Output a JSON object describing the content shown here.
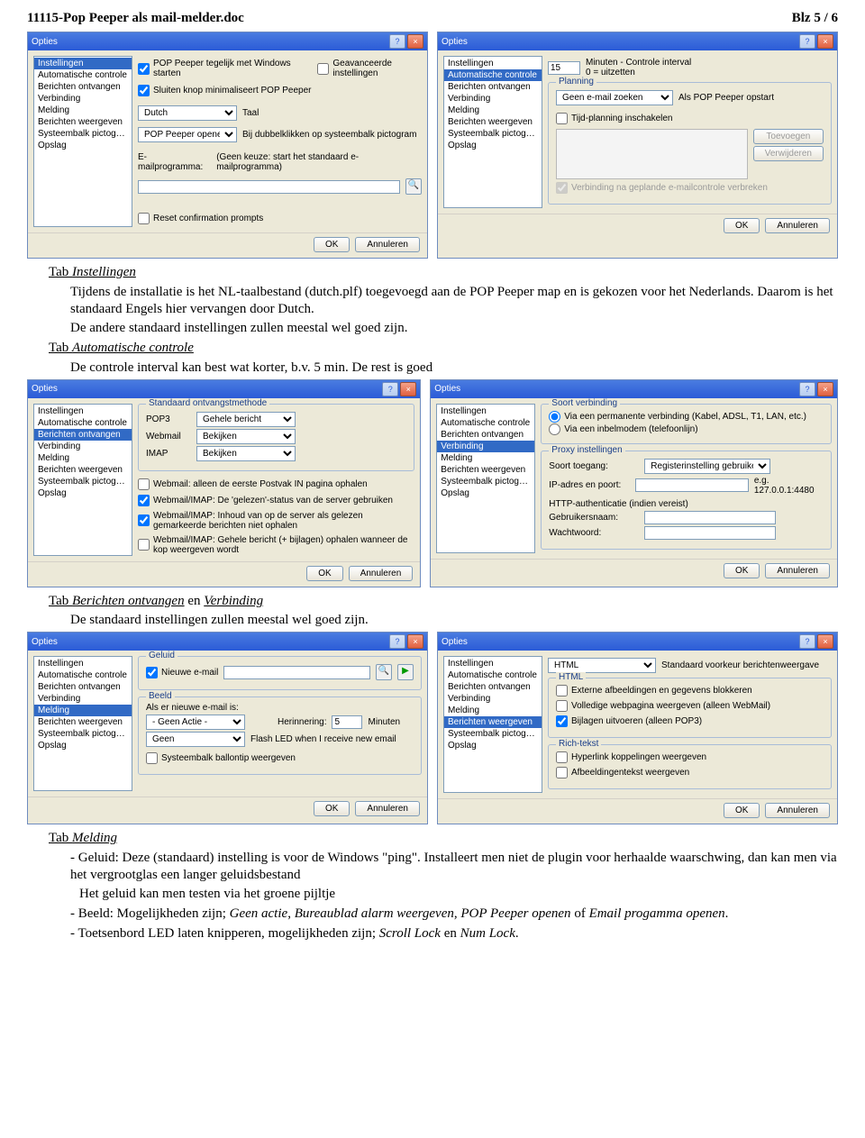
{
  "header": {
    "filename": "11115-Pop Peeper als mail-melder.doc",
    "page": "Blz 5 / 6"
  },
  "sidebar_items": [
    "Instellingen",
    "Automatische controle",
    "Berichten ontvangen",
    "Verbinding",
    "Melding",
    "Berichten weergeven",
    "Systeembalk pictogrammen",
    "Opslag"
  ],
  "dlg_title": "Opties",
  "ok": "OK",
  "cancel": "Annuleren",
  "d1": {
    "chk1": "POP Peeper tegelijk met Windows starten",
    "chk2": "Sluiten knop minimaliseert POP Peeper",
    "chk3": "Geavanceerde instellingen",
    "lang": "Dutch",
    "lang_label": "Taal",
    "action": "POP Peeper openen",
    "action_label": "Bij dubbelklikken op systeembalk pictogram",
    "mail_label": "E-mailprogramma:",
    "mail_val": "(Geen keuze: start het standaard e-mailprogramma)",
    "reset": "Reset confirmation prompts"
  },
  "d2": {
    "interval": "15",
    "interval_label": "Minuten - Controle interval\n0 = uitzetten",
    "grp": "Planning",
    "action": "Geen e-mail zoeken",
    "action_label": "Als POP Peeper opstart",
    "chk1": "Tijd-planning inschakelen",
    "add": "Toevoegen",
    "del": "Verwijderen",
    "chk2": "Verbinding na geplande e-mailcontrole verbreken"
  },
  "d3": {
    "grp": "Standaard ontvangstmethode",
    "r1": "POP3",
    "r1v": "Gehele bericht",
    "r2": "Webmail",
    "r2v": "Bekijken",
    "r3": "IMAP",
    "r3v": "Bekijken",
    "c1": "Webmail: alleen de eerste Postvak IN pagina ophalen",
    "c2": "Webmail/IMAP: De 'gelezen'-status van de server gebruiken",
    "c3": "Webmail/IMAP: Inhoud van op de server als gelezen gemarkeerde berichten niet ophalen",
    "c4": "Webmail/IMAP: Gehele bericht (+ bijlagen) ophalen wanneer de kop weergeven wordt"
  },
  "d4": {
    "grp1": "Soort verbinding",
    "rad1": "Via een permanente verbinding (Kabel, ADSL, T1, LAN, etc.)",
    "rad2": "Via een inbelmodem (telefoonlijn)",
    "grp2": "Proxy instellingen",
    "f1": "Soort toegang:",
    "f1v": "Registerinstelling gebruiken",
    "f2": "IP-adres en poort:",
    "f2h": "e.g. 127.0.0.1:4480",
    "f3": "HTTP-authenticatie (indien vereist)",
    "f4": "Gebruikersnaam:",
    "f5": "Wachtwoord:"
  },
  "d5": {
    "grp1": "Geluid",
    "c1": "Nieuwe e-mail",
    "grp2": "Beeld",
    "lbl1": "Als er nieuwe e-mail is:",
    "sel1": "- Geen Actie -",
    "lbl2": "Herinnering:",
    "val2": "5",
    "lbl3": "Minuten",
    "sel2": "Geen",
    "lbl4": "Flash LED when I receive new email",
    "c2": "Systeembalk ballontip weergeven"
  },
  "d6": {
    "sel1": "HTML",
    "lbl1": "Standaard voorkeur berichtenweergave",
    "grp1": "HTML",
    "c1": "Externe afbeeldingen en gegevens blokkeren",
    "c2": "Volledige webpagina weergeven (alleen WebMail)",
    "c3": "Bijlagen uitvoeren (alleen POP3)",
    "grp2": "Rich-tekst",
    "c4": "Hyperlink koppelingen weergeven",
    "c5": "Afbeeldingentekst weergeven"
  },
  "txt": {
    "t1a": "Tab ",
    "t1b": "Instellingen",
    "p1": "Tijdens de installatie is het NL-taalbestand (dutch.plf) toegevoegd aan de POP Peeper map en is gekozen voor het Nederlands. Daarom is het standaard Engels hier vervangen door Dutch.",
    "p2": "De andere standaard instellingen zullen meestal wel goed zijn.",
    "t2": "Automatische controle",
    "p3": "De controle interval kan best wat korter, b.v. 5 min. De rest is goed",
    "t3a": "Berichten ontvangen",
    "t3b": " en ",
    "t3c": "Verbinding",
    "p4": "De standaard instellingen zullen meestal wel goed zijn.",
    "t4": "Melding",
    "p5": "- Geluid: Deze (standaard) instelling is voor de Windows \"ping\". Installeert men niet de plugin voor herhaalde waarschwing, dan kan men via het vergrootglas een langer geluidsbestand",
    "p6": "Het geluid kan men testen via het groene pijltje",
    "p7a": "- Beeld: Mogelijkheden zijn; ",
    "p7b": "Geen actie",
    "p7c": ", ",
    "p7d": "Bureaublad alarm weergeven",
    "p7e": ", ",
    "p7f": "POP Peeper openen",
    "p7g": " of ",
    "p7h": "Email progamma openen",
    "p7i": ".",
    "p8a": "- Toetsenbord LED laten knipperen, mogelijkheden zijn; ",
    "p8b": "Scroll Lock",
    "p8c": " en ",
    "p8d": "Num Lock",
    "p8e": "."
  }
}
